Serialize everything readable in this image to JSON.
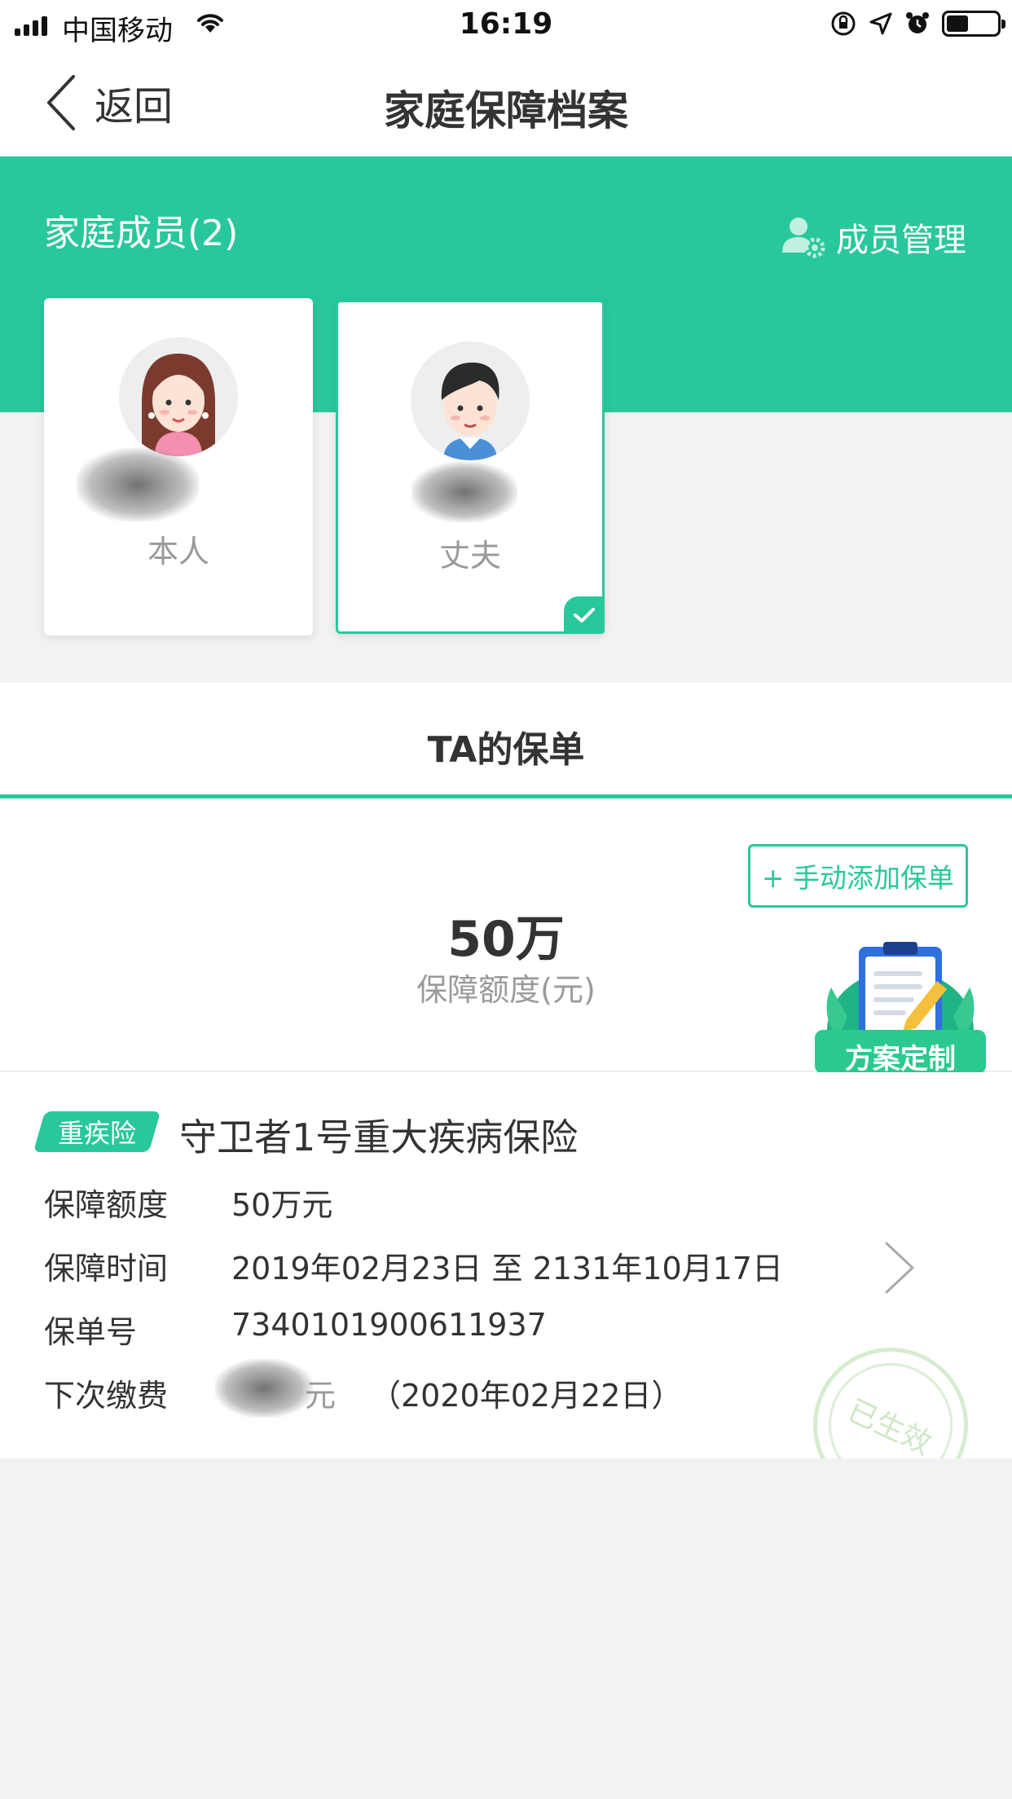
{
  "status_bar": {
    "carrier": "中国移动",
    "time": "16:19"
  },
  "nav": {
    "back_label": "返回",
    "title": "家庭保障档案"
  },
  "family": {
    "title": "家庭成员(2)",
    "manage_label": "成员管理",
    "members": [
      {
        "role": "本人",
        "selected": false
      },
      {
        "role": "丈夫",
        "selected": true
      }
    ]
  },
  "tabs": {
    "policy_tab": "TA的保单"
  },
  "summary": {
    "add_button": "+ 手动添加保单",
    "amount": "50万",
    "amount_label": "保障额度(元)",
    "plan_badge": "方案定制"
  },
  "policy": {
    "tag": "重疾险",
    "name": "守卫者1号重大疾病保险",
    "rows": [
      {
        "key": "保障额度",
        "value": "50万元"
      },
      {
        "key": "保障时间",
        "value": "2019年02月23日 至 2131年10月17日"
      },
      {
        "key": "保单号",
        "value": "7340101900611937"
      },
      {
        "key": "下次缴费",
        "value_suffix": "元",
        "value_date": "（2020年02月22日）"
      }
    ],
    "stamp": "已生效"
  },
  "colors": {
    "accent": "#29c89c",
    "background": "#f2f2f2"
  }
}
